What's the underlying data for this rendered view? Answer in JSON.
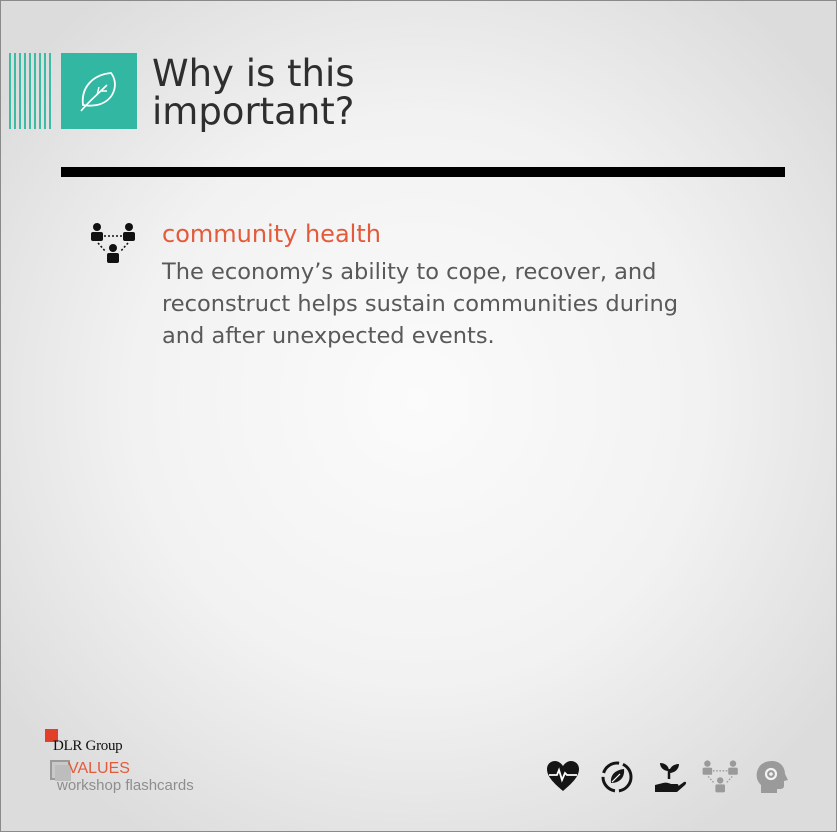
{
  "header": {
    "title_line1": "Why is this",
    "title_line2": "important?",
    "icon": "leaf-icon",
    "accent_color": "#32b8a2"
  },
  "topic": {
    "icon": "community-network-icon",
    "heading": "community health",
    "heading_color": "#e35b3a",
    "body": "The economy’s ability to cope, recover, and reconstruct helps sustain communities during and after unexpected events."
  },
  "footer": {
    "brand": "DLR Group",
    "values_label": "VALUES",
    "subtitle": "workshop flashcards",
    "icons": [
      "heart-pulse-icon",
      "recycle-leaf-icon",
      "hand-sprout-icon",
      "community-network-icon",
      "head-gear-icon"
    ]
  }
}
